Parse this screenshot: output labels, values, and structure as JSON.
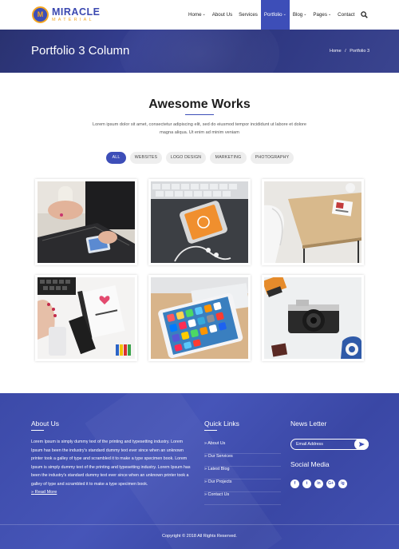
{
  "brand": {
    "title": "MIRACLE",
    "subtitle": "MATERIAL"
  },
  "nav": {
    "items": [
      {
        "label": "Home",
        "caret": true
      },
      {
        "label": "About Us",
        "caret": false
      },
      {
        "label": "Services",
        "caret": false
      },
      {
        "label": "Portfolio",
        "caret": true,
        "active": true
      },
      {
        "label": "Blog",
        "caret": true
      },
      {
        "label": "Pages",
        "caret": true
      },
      {
        "label": "Contact",
        "caret": false
      }
    ],
    "search_icon": "search-icon"
  },
  "banner": {
    "title": "Portfolio 3 Column",
    "breadcrumb": {
      "home": "Home",
      "separator": "/",
      "current": "Portfolio 3"
    }
  },
  "section": {
    "title": "Awesome Works",
    "description": "Lorem ipsum dolor sit amet, consectetur adipiscing elit, sed do eiusmod tempor incididunt ut labore et dolore magna aliqua. Ut enim ad minim veniam"
  },
  "filters": [
    "ALL",
    "WEBSITES",
    "LOGO DESIGN",
    "MARKETING",
    "PHOTOGRAPHY"
  ],
  "portfolio": [
    "laptop-phone-photo",
    "keyboard-phone-photo",
    "desk-chair-photo",
    "notebook-hands-photo",
    "tablet-apps-photo",
    "camera-photo"
  ],
  "footer": {
    "about": {
      "heading": "About Us",
      "text": "Lorem Ipsum is simply dummy text of the printing and typesetting industry. Lorem Ipsum has been the industry's standard dummy text ever since when an unknown printer took a galley of type and scrambled it to make a type specimen book. Lorem Ipsum is simply dummy text of the printing and typesetting industry. Lorem Ipsum has been the industry's standard dummy text ever since when an unknown printer took a galley of type and scrambled it to make a type specimen book.",
      "read_more": "Read More"
    },
    "quick_links": {
      "heading": "Quick Links",
      "items": [
        "About Us",
        "Our Services",
        "Latest Blog",
        "Our Projects",
        "Contact Us"
      ]
    },
    "newsletter": {
      "heading": "News Letter",
      "placeholder": "Email Address"
    },
    "social": {
      "heading": "Social Media",
      "icons": [
        "f",
        "t",
        "in",
        "G+",
        "ig"
      ]
    },
    "copyright": "Copyright © 2018 All Rights Reserved."
  },
  "colors": {
    "accent": "#3d4eb8",
    "brand_orange": "#f4a621",
    "banner": "#2d3680",
    "footer": "#4251b2"
  }
}
